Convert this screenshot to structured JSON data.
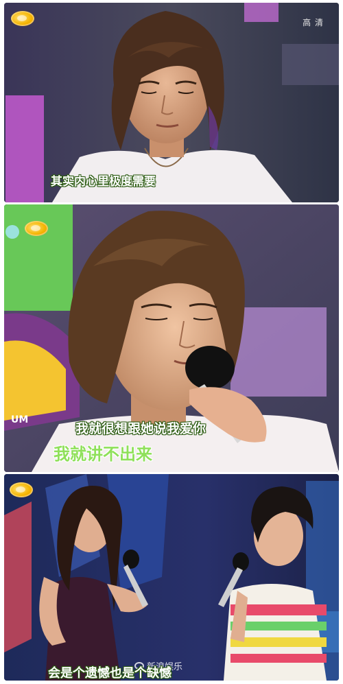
{
  "panel_1": {
    "hd_badge": "高 清",
    "subtitle": "其实内心里极度需要"
  },
  "panel_2": {
    "subtitle_line1": "我就很想跟她说我爱你",
    "subtitle_line2": "我就讲不出来"
  },
  "panel_3": {
    "subtitle": "会是个遗憾也是个缺憾",
    "watermark": "新浪娱乐"
  },
  "colors": {
    "subtitle_text": "#ffffff",
    "subtitle_highlight": "#8fe05a",
    "logo_orange": "#f5b400"
  }
}
